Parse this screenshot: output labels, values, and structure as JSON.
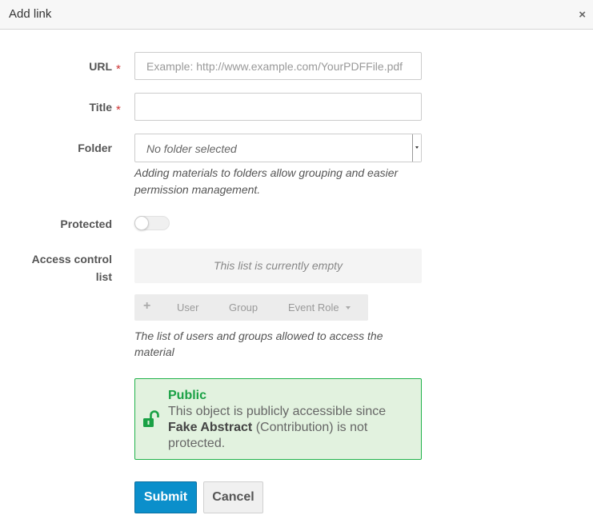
{
  "dialog": {
    "title": "Add link",
    "close_symbol": "×"
  },
  "form": {
    "url": {
      "label": "URL",
      "required_mark": "*",
      "placeholder": "Example: http://www.example.com/YourPDFFile.pdf",
      "value": ""
    },
    "title": {
      "label": "Title",
      "required_mark": "*",
      "value": ""
    },
    "folder": {
      "label": "Folder",
      "selected": "No folder selected",
      "help": "Adding materials to folders allow grouping and easier permission management."
    },
    "protected": {
      "label": "Protected",
      "checked": false
    },
    "acl": {
      "label_line1": "Access control",
      "label_line2": "list",
      "empty_text": "This list is currently empty",
      "toolbar": {
        "add_icon": "+",
        "user": "User",
        "group": "Group",
        "event_role": "Event Role"
      },
      "help": "The list of users and groups allowed to access the material"
    },
    "public_notice": {
      "title": "Public",
      "text_before": "This object is publicly accessible since",
      "entity": "Fake Abstract",
      "text_after": "(Contribution) is not protected.",
      "icon": "unlock-icon"
    }
  },
  "buttons": {
    "submit": "Submit",
    "cancel": "Cancel"
  },
  "colors": {
    "accent": "#0b8fcb",
    "success": "#1aa145",
    "success_bg": "#e2f2df",
    "required": "#cc3333"
  }
}
